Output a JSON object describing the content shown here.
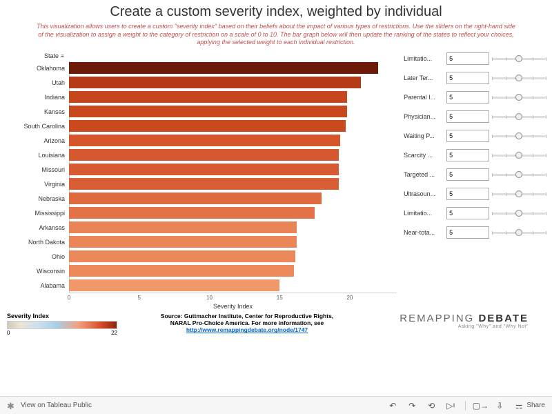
{
  "title": "Create a custom severity index, weighted by individual",
  "subtitle": "This visualization allows users to create a custom \"severity index\" based on their beliefs about the impact of various types of restrictions. Use the sliders on the right-hand side of the visualization to assign a weight to the category of restriction on a scale of 0 to 10. The bar graph below will then update the ranking of the states to reflect your choices, applying the selected weight to each individual restriction.",
  "axis_title": "State",
  "x_label": "Severity Index",
  "chart_data": {
    "type": "bar",
    "orientation": "horizontal",
    "xlabel": "Severity Index",
    "ylabel": "State",
    "xlim": [
      0,
      23
    ],
    "x_ticks": [
      0,
      5,
      10,
      15,
      20
    ],
    "categories": [
      "Oklahoma",
      "Utah",
      "Indiana",
      "Kansas",
      "South Carolina",
      "Arizona",
      "Louisiana",
      "Missouri",
      "Virginia",
      "Nebraska",
      "Mississippi",
      "Arkansas",
      "North Dakota",
      "Ohio",
      "Wisconsin",
      "Alabama"
    ],
    "values": [
      22.0,
      20.8,
      19.8,
      19.8,
      19.7,
      19.3,
      19.2,
      19.2,
      19.2,
      18.0,
      17.5,
      16.2,
      16.2,
      16.1,
      16.0,
      15.0
    ],
    "colors": [
      "#6e1a08",
      "#b33a15",
      "#c6471c",
      "#c8481d",
      "#ca4a1e",
      "#d5562a",
      "#d65830",
      "#d75a32",
      "#d85c34",
      "#e06a40",
      "#e37248",
      "#e98456",
      "#ea8658",
      "#eb885a",
      "#ec8a5c",
      "#f09868"
    ],
    "color_legend": {
      "title": "Severity Index",
      "min": 0,
      "max": 22
    }
  },
  "controls": [
    {
      "label": "Limitatio...",
      "value": "5"
    },
    {
      "label": "Later Ter...",
      "value": "5"
    },
    {
      "label": "Parental I...",
      "value": "5"
    },
    {
      "label": "Physician...",
      "value": "5"
    },
    {
      "label": "Waiting P...",
      "value": "5"
    },
    {
      "label": "Scarcity ...",
      "value": "5"
    },
    {
      "label": "Targeted ...",
      "value": "5"
    },
    {
      "label": "Ultrasoun...",
      "value": "5"
    },
    {
      "label": "Limitatio...",
      "value": "5"
    },
    {
      "label": "Near-tota...",
      "value": "5"
    }
  ],
  "legend": {
    "title": "Severity Index",
    "min": "0",
    "max": "22"
  },
  "source": {
    "text": "Source: Guttmacher Institute, Center for Reproductive Rights, NARAL Pro-Choice America. For more information, see ",
    "link": "http://www.remappingdebate.org/node/1747"
  },
  "brand": {
    "pre": "REMAPPING ",
    "em": "DEBATE",
    "sub": "Asking \"Why\" and \"Why Not\""
  },
  "toolbar": {
    "view": "View on Tableau Public",
    "share": "Share"
  }
}
